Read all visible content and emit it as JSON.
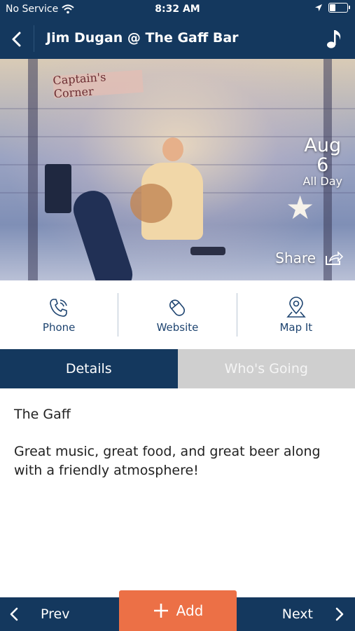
{
  "status": {
    "carrier": "No Service",
    "time": "8:32 AM",
    "battery_level": 0.35
  },
  "nav": {
    "title": "Jim Dugan @ The Gaff Bar",
    "back_icon": "chevron-left-icon",
    "right_icon": "music-note-icon"
  },
  "hero": {
    "sign_text": "Captain's Corner",
    "date_month": "Aug",
    "date_day": "6",
    "date_time": "All Day",
    "share_label": "Share"
  },
  "actions": [
    {
      "label": "Phone",
      "icon": "phone-icon"
    },
    {
      "label": "Website",
      "icon": "mouse-icon"
    },
    {
      "label": "Map It",
      "icon": "map-pin-icon"
    }
  ],
  "tabs": {
    "details": "Details",
    "whos_going": "Who's Going"
  },
  "details": {
    "venue": "The Gaff",
    "description": "Great music, great food, and great beer along with a friendly atmosphere!"
  },
  "bottom": {
    "prev_label": "Prev",
    "add_label": "Add",
    "next_label": "Next"
  },
  "colors": {
    "primary": "#14385e",
    "accent": "#ec7046",
    "tab_inactive": "#cfcfcf"
  }
}
